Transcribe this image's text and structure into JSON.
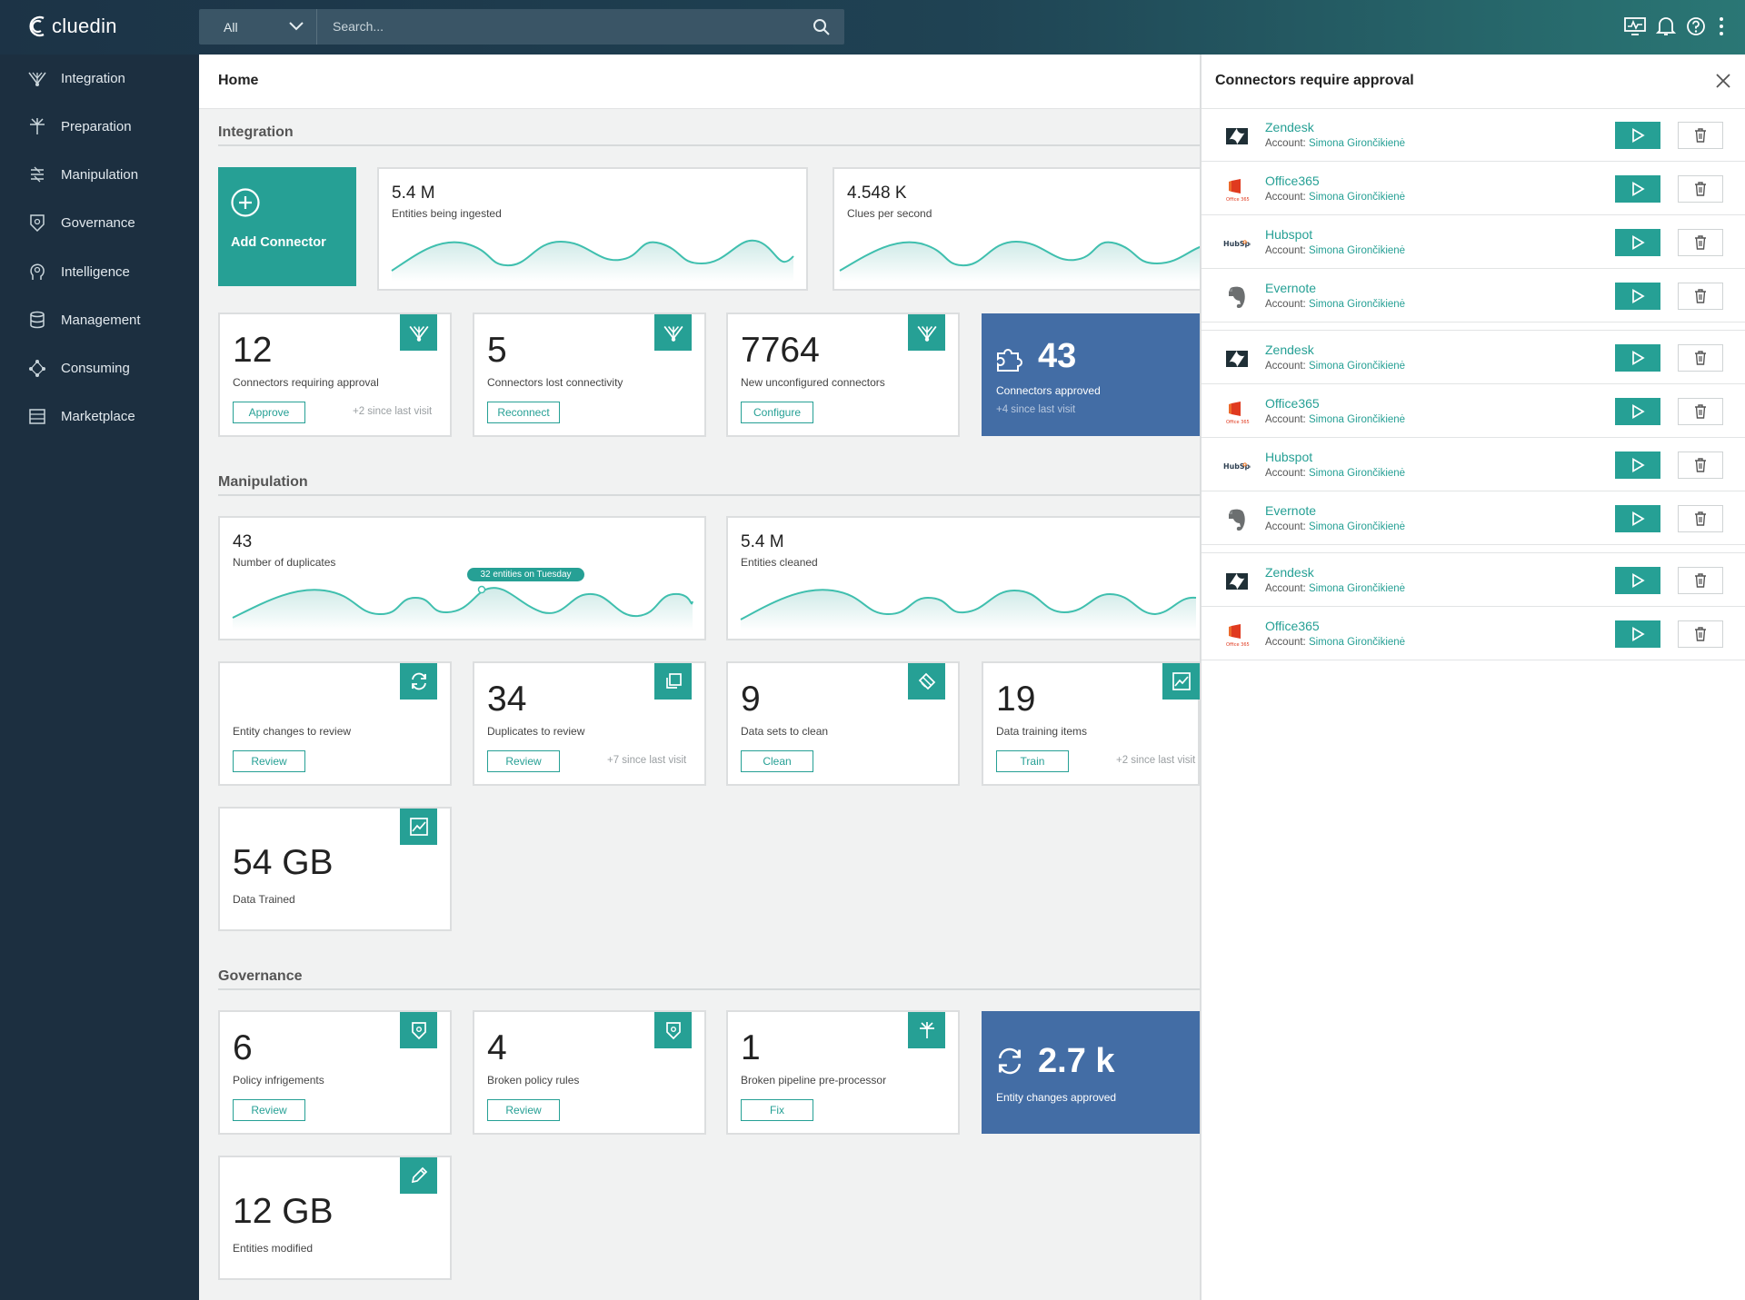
{
  "app": {
    "brand": "cluedin"
  },
  "search": {
    "scope": "All",
    "placeholder": "Search..."
  },
  "sidebar": {
    "items": [
      {
        "label": "Integration",
        "icon": "integration-icon"
      },
      {
        "label": "Preparation",
        "icon": "preparation-icon"
      },
      {
        "label": "Manipulation",
        "icon": "manipulation-icon"
      },
      {
        "label": "Governance",
        "icon": "governance-icon"
      },
      {
        "label": "Intelligence",
        "icon": "intelligence-icon"
      },
      {
        "label": "Management",
        "icon": "management-icon"
      },
      {
        "label": "Consuming",
        "icon": "consuming-icon"
      },
      {
        "label": "Marketplace",
        "icon": "marketplace-icon"
      }
    ]
  },
  "page": {
    "title": "Home"
  },
  "integration": {
    "title": "Integration",
    "add": {
      "label": "Add Connector"
    },
    "ingested": {
      "value": "5.4 M",
      "label": "Entities being ingested"
    },
    "clues": {
      "value": "4.548 K",
      "label": "Clues per second"
    },
    "approval": {
      "value": "12",
      "label": "Connectors requiring approval",
      "button": "Approve",
      "since": "+2 since last visit"
    },
    "lost": {
      "value": "5",
      "label": "Connectors lost connectivity",
      "button": "Reconnect"
    },
    "unconfigured": {
      "value": "7764",
      "label": "New unconfigured connectors",
      "button": "Configure"
    },
    "approved": {
      "value": "43",
      "label": "Connectors approved",
      "since": "+4 since last visit"
    }
  },
  "manipulation": {
    "title": "Manipulation",
    "duplicates": {
      "value": "43",
      "label": "Number of duplicates",
      "tooltip": "32 entities on Tuesday"
    },
    "cleaned": {
      "value": "5.4 M",
      "label": "Entities cleaned"
    },
    "changes": {
      "label": "Entity changes to review",
      "button": "Review"
    },
    "dupreview": {
      "value": "34",
      "label": "Duplicates to review",
      "button": "Review",
      "since": "+7 since last visit"
    },
    "datasets": {
      "value": "9",
      "label": "Data sets to clean",
      "button": "Clean"
    },
    "training": {
      "value": "19",
      "label": "Data training items",
      "button": "Train",
      "since": "+2 since last visit"
    },
    "trained": {
      "value": "54 GB",
      "label": "Data Trained"
    }
  },
  "governance": {
    "title": "Governance",
    "policy": {
      "value": "6",
      "label": "Policy infrigements",
      "button": "Review"
    },
    "broken": {
      "value": "4",
      "label": "Broken policy rules",
      "button": "Review"
    },
    "pipeline": {
      "value": "1",
      "label": "Broken pipeline pre-processor",
      "button": "Fix"
    },
    "approved": {
      "value": "2.7 k",
      "label": "Entity changes approved"
    },
    "modified": {
      "value": "12 GB",
      "label": "Entities modified"
    }
  },
  "panel": {
    "title": "Connectors require approval",
    "account_label": "Account:",
    "connectors": [
      {
        "name": "Zendesk",
        "account": "Simona Girončikienė",
        "logo": "zendesk-logo"
      },
      {
        "name": "Office365",
        "account": "Simona Girončikienė",
        "logo": "office365-logo"
      },
      {
        "name": "Hubspot",
        "account": "Simona Girončikienė",
        "logo": "hubspot-logo"
      },
      {
        "name": "Evernote",
        "account": "Simona Girončikienė",
        "logo": "evernote-logo"
      },
      {
        "name": "Zendesk",
        "account": "Simona Girončikienė",
        "logo": "zendesk-logo"
      },
      {
        "name": "Office365",
        "account": "Simona Girončikienė",
        "logo": "office365-logo"
      },
      {
        "name": "Hubspot",
        "account": "Simona Girončikienė",
        "logo": "hubspot-logo"
      },
      {
        "name": "Evernote",
        "account": "Simona Girončikienė",
        "logo": "evernote-logo"
      },
      {
        "name": "Zendesk",
        "account": "Simona Girončikienė",
        "logo": "zendesk-logo"
      },
      {
        "name": "Office365",
        "account": "Simona Girončikienė",
        "logo": "office365-logo"
      }
    ]
  },
  "colors": {
    "accent": "#26a095",
    "navy": "#1c2f40",
    "blue_card": "#436da5"
  }
}
